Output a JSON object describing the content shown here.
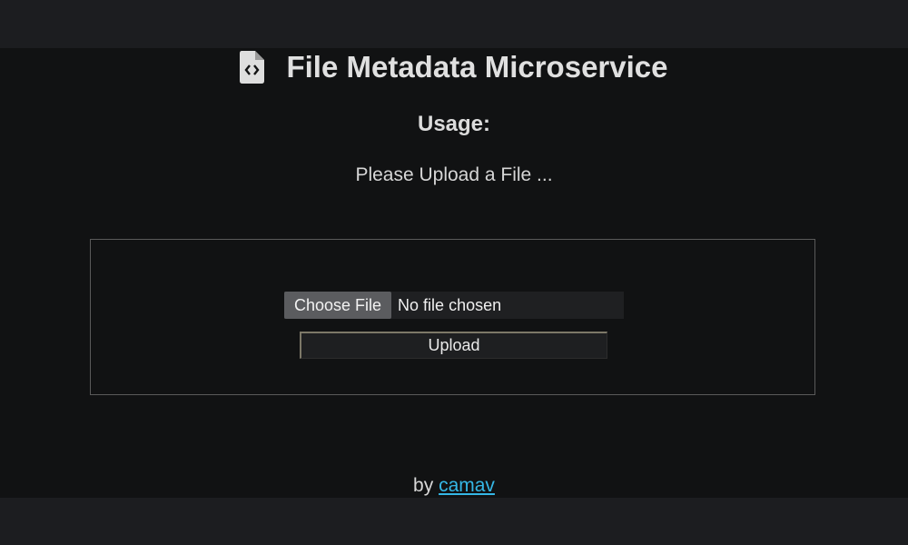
{
  "page": {
    "title": "File Metadata Microservice",
    "title_icon": "file-code-icon",
    "usage_heading": "Usage:",
    "prompt": "Please Upload a File ..."
  },
  "form": {
    "choose_label": "Choose File",
    "file_status": "No file chosen",
    "upload_label": "Upload"
  },
  "footer": {
    "by_text": "by",
    "author_link": "camav"
  },
  "colors": {
    "background": "#111213",
    "band": "#1c1d20",
    "link": "#35b7e6",
    "panel_border": "#5a5a5a"
  }
}
